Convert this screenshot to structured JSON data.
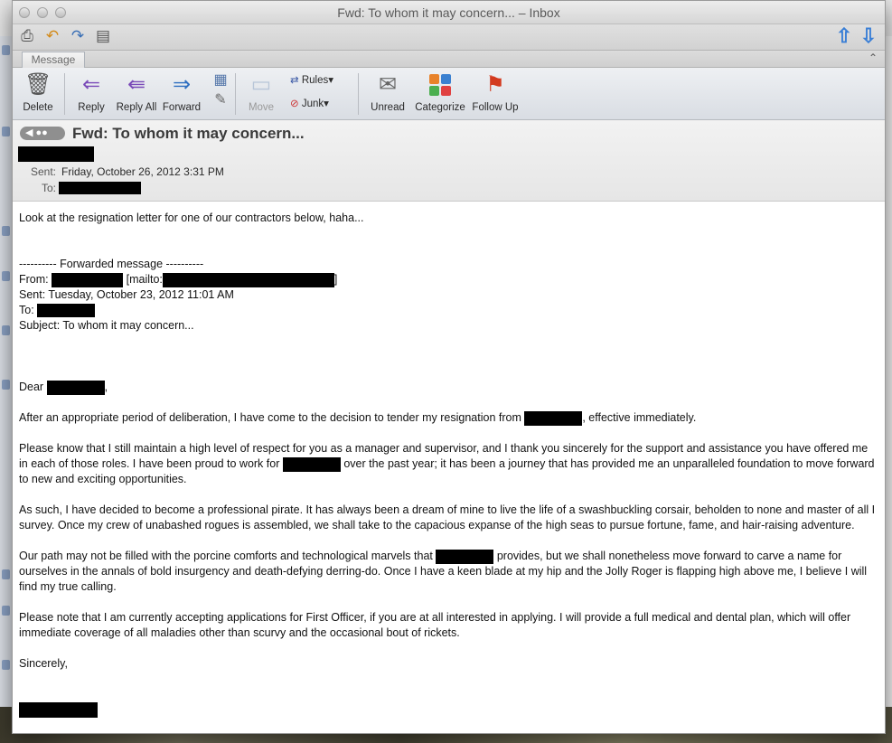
{
  "window": {
    "title": "Fwd: To whom it may concern... – Inbox"
  },
  "ribbon": {
    "tab_label": "Message",
    "buttons": {
      "delete": "Delete",
      "reply": "Reply",
      "reply_all": "Reply All",
      "forward": "Forward",
      "move": "Move",
      "rules": "Rules",
      "junk": "Junk",
      "unread": "Unread",
      "categorize": "Categorize",
      "follow_up": "Follow Up"
    }
  },
  "message": {
    "subject": "Fwd: To whom it may concern...",
    "sent_label": "Sent:",
    "sent_value": "Friday, October 26, 2012 3:31 PM",
    "to_label": "To:"
  },
  "body": {
    "intro": "Look at the resignation letter for one of our contractors below, haha...",
    "forward_divider": "---------- Forwarded message ----------",
    "from_label": "From:",
    "mailto_prefix": "[mailto:",
    "mailto_suffix": "]",
    "sent_line": "Sent: Tuesday, October 23, 2012 11:01 AM",
    "to_label": "To:",
    "subject_line": "Subject: To whom it may concern...",
    "salutation_prefix": "Dear",
    "salutation_suffix": ",",
    "p1_a": "After an appropriate period of deliberation, I have come to the decision to tender my resignation from",
    "p1_b": ", effective immediately.",
    "p2_a": "Please know that I still maintain a high level of respect for you as a manager and supervisor, and I thank you sincerely for the support and assistance you have offered me in each of those roles. I have been proud to work for",
    "p2_b": "over the past year; it has been a journey that has provided me an unparalleled foundation to move forward to new and exciting opportunities.",
    "p3": "As such, I have decided to become a professional pirate. It has always been a dream of mine to live the life of a swashbuckling corsair, beholden to none and master of all I survey. Once my crew of unabashed rogues is assembled, we shall take to the capacious expanse of the high seas to pursue fortune, fame, and hair-raising adventure.",
    "p4_a": "Our path may not be filled with the porcine comforts and technological marvels that",
    "p4_b": "provides, but we shall nonetheless move forward to carve a name for ourselves in the annals of bold insurgency and death-defying derring-do. Once I have a keen blade at my hip and the Jolly Roger is flapping high above me, I believe I will find my true calling.",
    "p5": "Please note that I am currently accepting applications for First Officer, if you are at all interested in applying. I will provide a full medical and dental plan, which will offer immediate coverage of all maladies other than scurvy and the occasional bout of rickets.",
    "closing": "Sincerely,"
  }
}
